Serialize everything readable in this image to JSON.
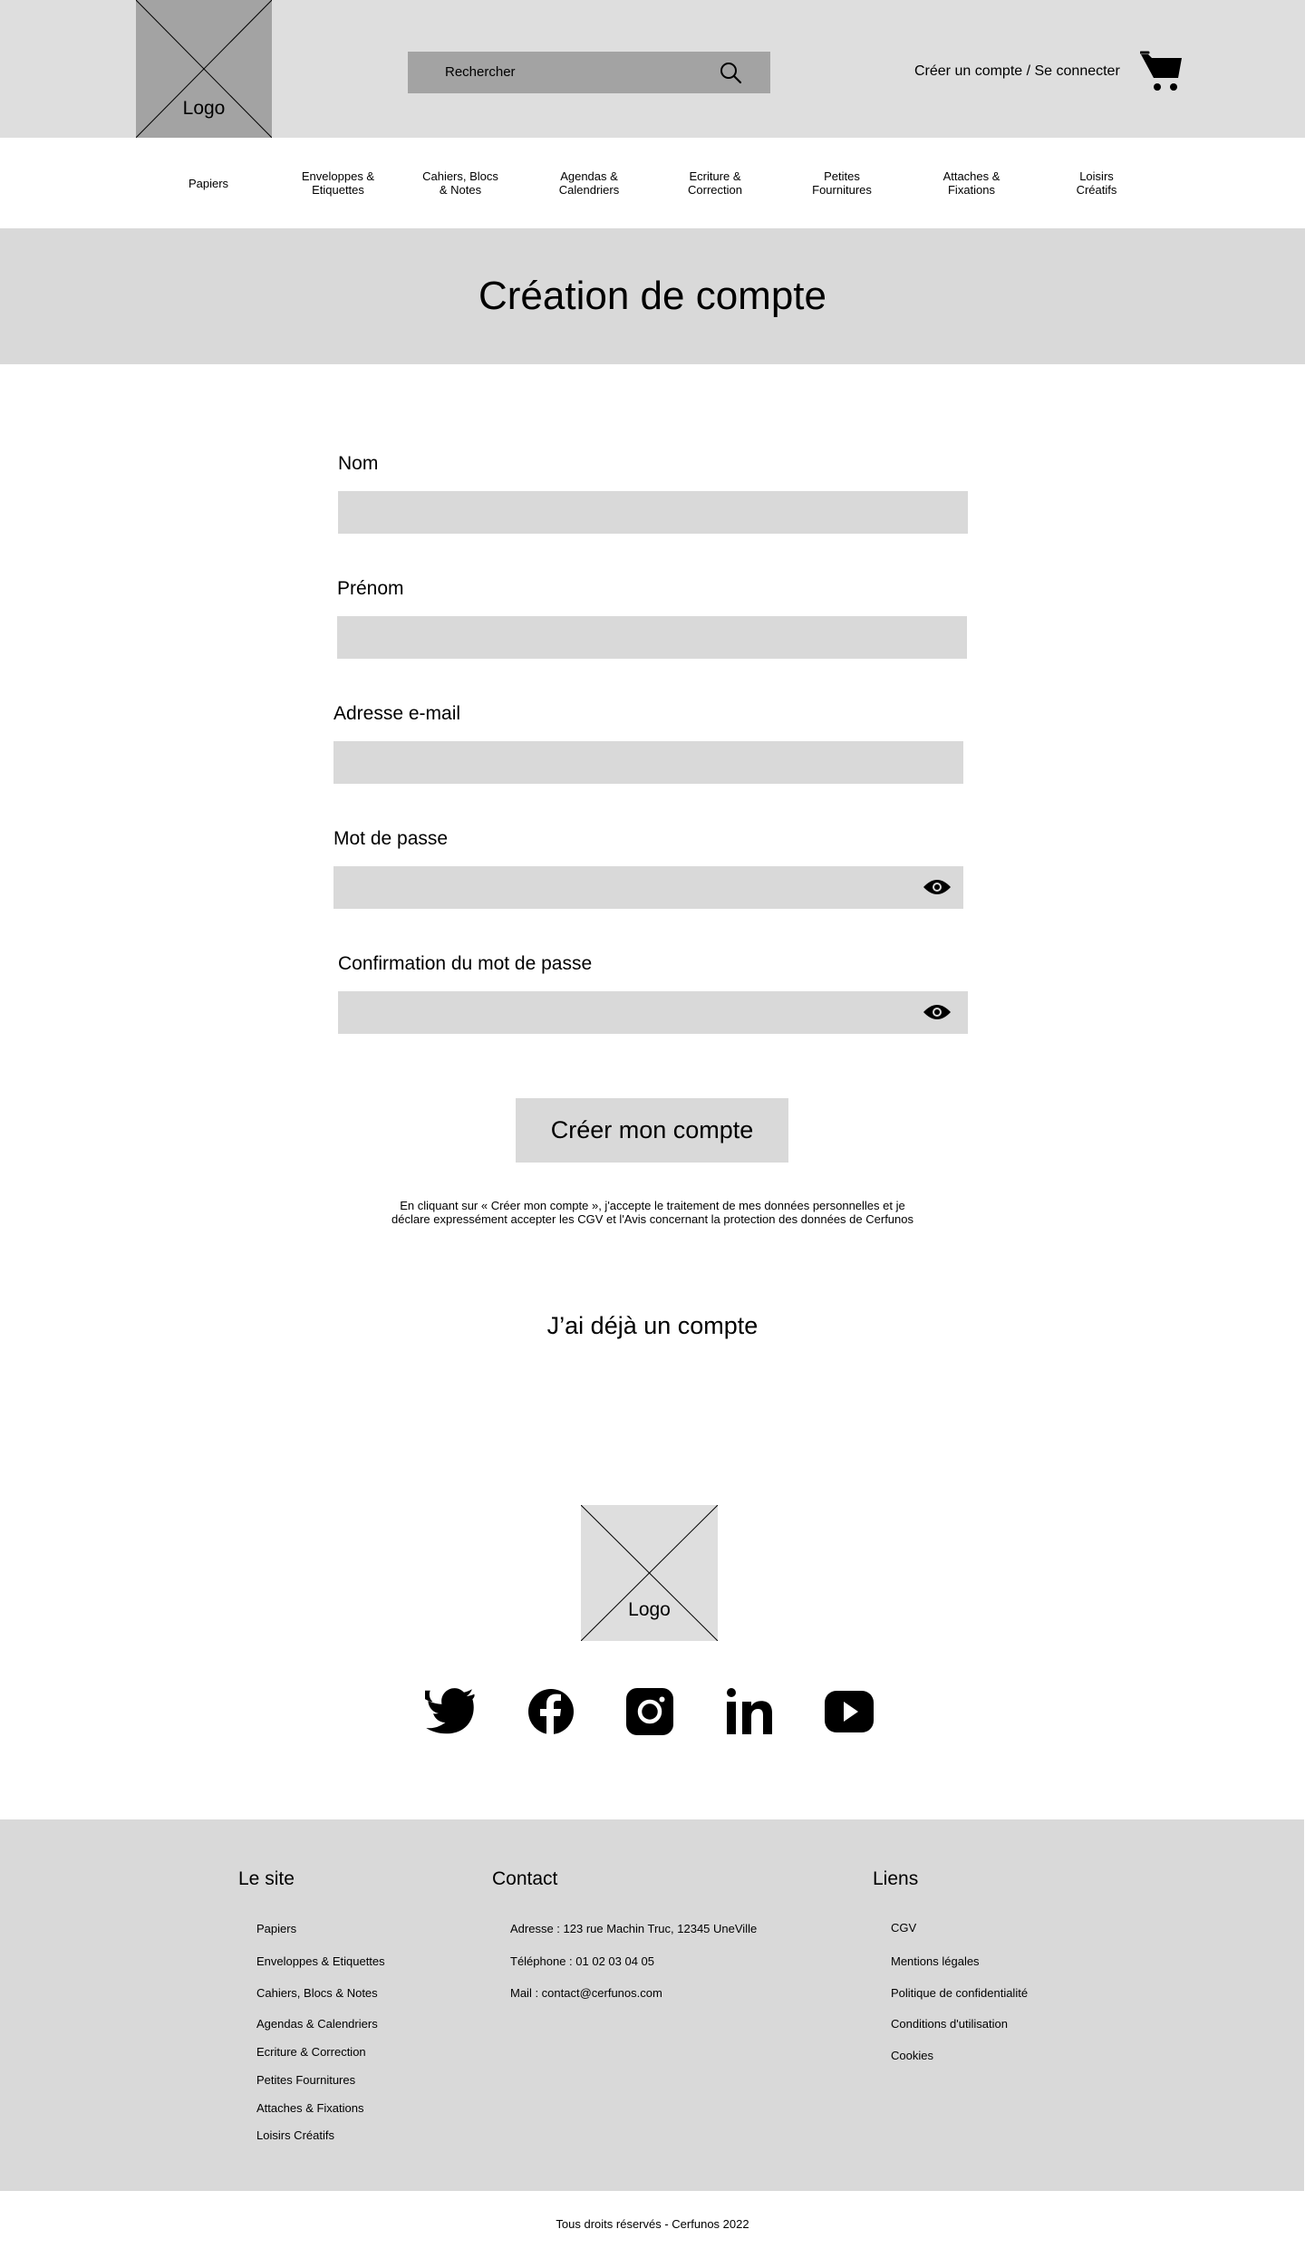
{
  "header": {
    "logo_label": "Logo",
    "search_placeholder": "Rechercher",
    "account_link": "Créer un compte / Se connecter",
    "search_icon": "search-icon",
    "cart_icon": "cart-icon"
  },
  "nav": {
    "items": [
      {
        "line1": "Papiers",
        "line2": ""
      },
      {
        "line1": "Enveloppes &",
        "line2": "Etiquettes"
      },
      {
        "line1": "Cahiers, Blocs",
        "line2": "& Notes"
      },
      {
        "line1": "Agendas &",
        "line2": "Calendriers"
      },
      {
        "line1": "Ecriture &",
        "line2": "Correction"
      },
      {
        "line1": "Petites",
        "line2": "Fournitures"
      },
      {
        "line1": "Attaches &",
        "line2": "Fixations"
      },
      {
        "line1": "Loisirs",
        "line2": "Créatifs"
      }
    ]
  },
  "page": {
    "title": "Création de compte"
  },
  "form": {
    "fields": [
      {
        "label": "Nom",
        "value": ""
      },
      {
        "label": "Prénom",
        "value": ""
      },
      {
        "label": "Adresse e-mail",
        "value": ""
      },
      {
        "label": "Mot de passe",
        "value": "",
        "icon": "eye-icon"
      },
      {
        "label": "Confirmation du mot de passe",
        "value": "",
        "icon": "eye-icon"
      }
    ],
    "submit_label": "Créer mon compte",
    "consent_text": "En cliquant sur « Créer mon compte », j'accepte le traitement de mes données personnelles et je déclare expressément accepter les CGV et l'Avis concernant la protection des données de Cerfunos",
    "login_link": "J’ai déjà un compte"
  },
  "footer_brand": {
    "logo_label": "Logo",
    "social_icons": [
      "twitter-icon",
      "facebook-icon",
      "instagram-icon",
      "linkedin-icon",
      "youtube-icon"
    ]
  },
  "footer": {
    "site": {
      "heading": "Le site",
      "links": [
        "Papiers",
        "Enveloppes & Etiquettes",
        "Cahiers, Blocs & Notes",
        "Agendas & Calendriers",
        "Ecriture & Correction",
        "Petites Fournitures",
        "Attaches & Fixations",
        "Loisirs Créatifs"
      ]
    },
    "contact": {
      "heading": "Contact",
      "lines": [
        "Adresse : 123 rue Machin Truc, 12345 UneVille",
        "Téléphone : 01 02 03 04 05",
        "Mail : contact@cerfunos.com"
      ]
    },
    "links": {
      "heading": "Liens",
      "items": [
        "CGV",
        "Mentions légales",
        "Politique de confidentialité",
        "Conditions d'utilisation",
        "Cookies"
      ]
    },
    "copyright": "Tous droits réservés - Cerfunos 2022"
  },
  "colors": {
    "header_bg": "#dedede",
    "placeholder_gray": "#a3a3a3",
    "input_bg": "#d9d9d9",
    "text": "#000000"
  }
}
